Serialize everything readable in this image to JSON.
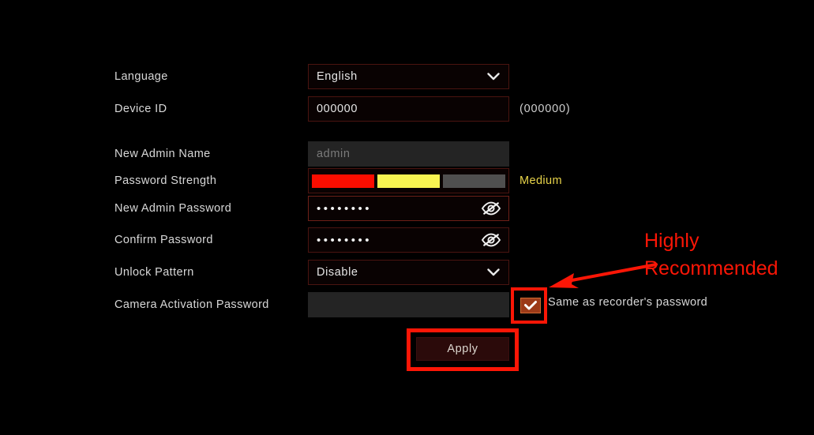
{
  "theme": {
    "background": "#000000",
    "label_color": "#d8d8d8",
    "field_bg": "#090202",
    "field_border": "#4a1410",
    "disabled_bg": "#242424",
    "disabled_text": "#7a7a7a",
    "highlight_red": "#fb1606",
    "checkbox_fill": "#9c3a18",
    "apply_fill": "#2b0a0a",
    "strength_label_color": "#e8d44a"
  },
  "form": {
    "rows": [
      {
        "name": "language",
        "label": "Language",
        "type": "select",
        "value": "English",
        "icon": "chevron-down-icon"
      },
      {
        "name": "device-id",
        "label": "Device ID",
        "type": "text",
        "value": "000000",
        "hint": "(000000)"
      },
      {
        "name": "new-admin-name",
        "label": "New Admin Name",
        "type": "text-disabled",
        "value": "admin"
      },
      {
        "name": "password-strength",
        "label": "Password Strength",
        "type": "meter",
        "level_text": "Medium",
        "segments": [
          {
            "name": "weak-segment",
            "color": "#fb0d00"
          },
          {
            "name": "medium-segment",
            "color": "#f8f451"
          },
          {
            "name": "strong-segment",
            "color": "#4f4f4f"
          }
        ]
      },
      {
        "name": "new-admin-password",
        "label": "New Admin Password",
        "type": "password",
        "value": "••••••••",
        "icon": "eye-off-icon"
      },
      {
        "name": "confirm-password",
        "label": "Confirm Password",
        "type": "password",
        "value": "••••••••",
        "icon": "eye-off-icon"
      },
      {
        "name": "unlock-pattern",
        "label": "Unlock Pattern",
        "type": "select",
        "value": "Disable",
        "icon": "chevron-down-icon"
      },
      {
        "name": "camera-activation-password",
        "label": "Camera Activation Password",
        "type": "text-disabled",
        "value": ""
      }
    ]
  },
  "checkbox": {
    "label": "Same as recorder's password",
    "checked": true,
    "icon": "check-icon"
  },
  "apply": {
    "label": "Apply"
  },
  "annotation": {
    "line1": "Highly",
    "line2": "Recommended",
    "arrow_icon": "arrow-left-icon"
  }
}
